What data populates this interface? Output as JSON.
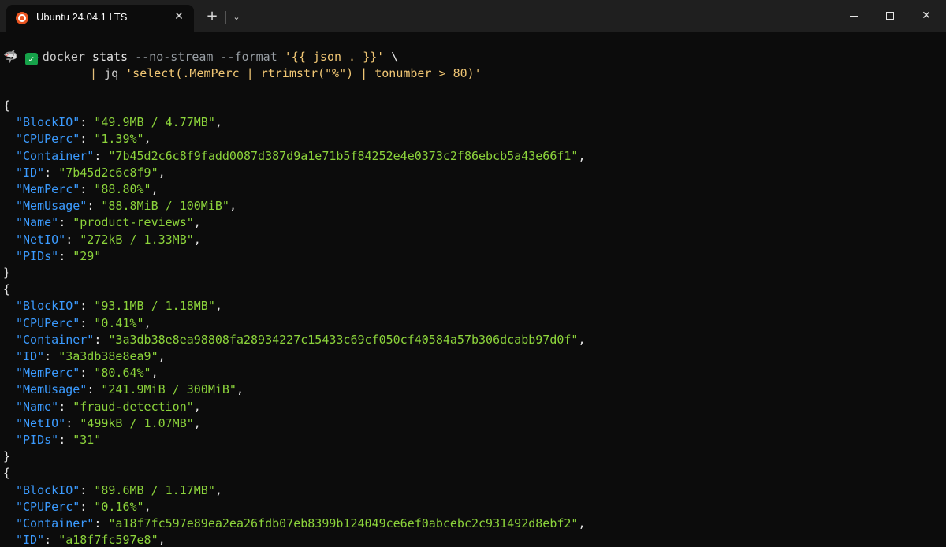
{
  "window": {
    "tab_title": "Ubuntu 24.04.1 LTS",
    "tab_close_glyph": "✕",
    "new_tab_glyph": "+",
    "dropdown_glyph": "⌄",
    "close_glyph": "✕"
  },
  "prompt": {
    "tilde": "~",
    "shark_glyph": "🦈",
    "check_glyph": "✓",
    "line1_cmd": "docker",
    "line1_rest1": " stats ",
    "line1_opt1": "--no-stream",
    "line1_opt2": " --format ",
    "line1_str": "'{{ json . }}'",
    "line1_tail": " \\",
    "line2_pipe": "| ",
    "line2_cmd": "jq ",
    "line2_str": "'select(.MemPerc | rtrimstr(\"%\") | tonumber > 80)'"
  },
  "output": [
    {
      "entries": [
        {
          "key": "BlockIO",
          "value": "49.9MB / 4.77MB"
        },
        {
          "key": "CPUPerc",
          "value": "1.39%"
        },
        {
          "key": "Container",
          "value": "7b45d2c6c8f9fadd0087d387d9a1e71b5f84252e4e0373c2f86ebcb5a43e66f1"
        },
        {
          "key": "ID",
          "value": "7b45d2c6c8f9"
        },
        {
          "key": "MemPerc",
          "value": "88.80%"
        },
        {
          "key": "MemUsage",
          "value": "88.8MiB / 100MiB"
        },
        {
          "key": "Name",
          "value": "product-reviews"
        },
        {
          "key": "NetIO",
          "value": "272kB / 1.33MB"
        },
        {
          "key": "PIDs",
          "value": "29"
        }
      ]
    },
    {
      "entries": [
        {
          "key": "BlockIO",
          "value": "93.1MB / 1.18MB"
        },
        {
          "key": "CPUPerc",
          "value": "0.41%"
        },
        {
          "key": "Container",
          "value": "3a3db38e8ea98808fa28934227c15433c69cf050cf40584a57b306dcabb97d0f"
        },
        {
          "key": "ID",
          "value": "3a3db38e8ea9"
        },
        {
          "key": "MemPerc",
          "value": "80.64%"
        },
        {
          "key": "MemUsage",
          "value": "241.9MiB / 300MiB"
        },
        {
          "key": "Name",
          "value": "fraud-detection"
        },
        {
          "key": "NetIO",
          "value": "499kB / 1.07MB"
        },
        {
          "key": "PIDs",
          "value": "31"
        }
      ]
    },
    {
      "entries": [
        {
          "key": "BlockIO",
          "value": "89.6MB / 1.17MB"
        },
        {
          "key": "CPUPerc",
          "value": "0.16%"
        },
        {
          "key": "Container",
          "value": "a18f7fc597e89ea2ea26fdb07eb8399b124049ce6ef0abcebc2c931492d8ebf2"
        },
        {
          "key": "ID",
          "value": "a18f7fc597e8"
        }
      ]
    }
  ],
  "colors": {
    "background": "#0c0c0c",
    "titlebar": "#1f1f1f",
    "json_key": "#3b9bff",
    "json_value": "#8cd43b",
    "ubuntu_orange": "#e95420",
    "check_green": "#16a34a"
  }
}
